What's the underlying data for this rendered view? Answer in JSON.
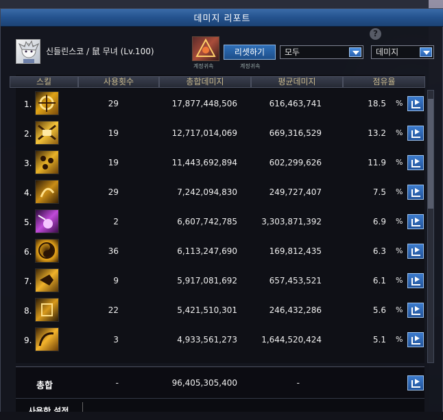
{
  "window": {
    "title": "데미지 리포트"
  },
  "header": {
    "character": "신들린스코 / 鼠 무녀 (Lv.100)",
    "class_icon_label": "계정귀속",
    "reset_button": "리셋하기",
    "reset_sub_label": "계정귀속",
    "filter_select": "모두",
    "metric_select": "데미지",
    "help_icon": "?"
  },
  "columns": [
    "스킬",
    "사용횟수",
    "총합데미지",
    "평균데미지",
    "점유율"
  ],
  "rows": [
    {
      "rank": "1.",
      "uses": "29",
      "total": "17,877,448,506",
      "avg": "616,463,741",
      "share": "18.5",
      "icon": "skill-icon-1"
    },
    {
      "rank": "2.",
      "uses": "19",
      "total": "12,717,014,069",
      "avg": "669,316,529",
      "share": "13.2",
      "icon": "skill-icon-2"
    },
    {
      "rank": "3.",
      "uses": "19",
      "total": "11,443,692,894",
      "avg": "602,299,626",
      "share": "11.9",
      "icon": "skill-icon-3"
    },
    {
      "rank": "4.",
      "uses": "29",
      "total": "7,242,094,830",
      "avg": "249,727,407",
      "share": "7.5",
      "icon": "skill-icon-4"
    },
    {
      "rank": "5.",
      "uses": "2",
      "total": "6,607,742,785",
      "avg": "3,303,871,392",
      "share": "6.9",
      "icon": "skill-icon-5"
    },
    {
      "rank": "6.",
      "uses": "36",
      "total": "6,113,247,690",
      "avg": "169,812,435",
      "share": "6.3",
      "icon": "skill-icon-6"
    },
    {
      "rank": "7.",
      "uses": "9",
      "total": "5,917,081,692",
      "avg": "657,453,521",
      "share": "6.1",
      "icon": "skill-icon-7"
    },
    {
      "rank": "8.",
      "uses": "22",
      "total": "5,421,510,301",
      "avg": "246,432,286",
      "share": "5.6",
      "icon": "skill-icon-8"
    },
    {
      "rank": "9.",
      "uses": "3",
      "total": "4,933,561,273",
      "avg": "1,644,520,424",
      "share": "5.1",
      "icon": "skill-icon-9"
    }
  ],
  "percent_sign": "%",
  "total": {
    "label": "총합",
    "uses": "-",
    "total": "96,405,305,400",
    "avg": "-"
  },
  "settings": {
    "label": "사용한 설정"
  },
  "colors": {
    "title_bar": "#24528e",
    "header_text": "#c9b98d",
    "button": "#2f6fb8"
  }
}
